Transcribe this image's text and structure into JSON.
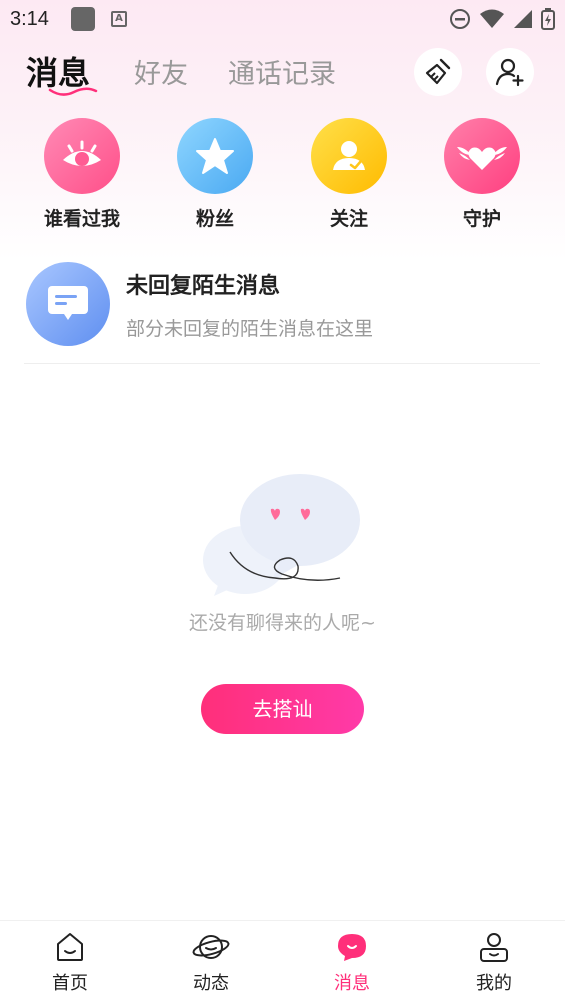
{
  "status_bar": {
    "time": "3:14",
    "notif_letter": "A"
  },
  "header": {
    "tabs": [
      {
        "label": "消息",
        "active": true
      },
      {
        "label": "好友",
        "active": false
      },
      {
        "label": "通话记录",
        "active": false
      }
    ],
    "clean_icon": "broom-icon",
    "add_friend_icon": "add-user-icon"
  },
  "shortcuts": [
    {
      "label": "谁看过我",
      "icon": "eye-icon",
      "color": "#ff5c93"
    },
    {
      "label": "粉丝",
      "icon": "star-icon",
      "color": "#5bbdf7"
    },
    {
      "label": "关注",
      "icon": "person-check-icon",
      "color": "#ffc61a"
    },
    {
      "label": "守护",
      "icon": "winged-heart-icon",
      "color": "#ff4d8d"
    }
  ],
  "stranger_msg": {
    "title": "未回复陌生消息",
    "subtitle": "部分未回复的陌生消息在这里"
  },
  "empty_state": {
    "text": "还没有聊得来的人呢~",
    "cta_label": "去搭讪"
  },
  "bottom_nav": [
    {
      "label": "首页",
      "icon": "home-icon",
      "active": false
    },
    {
      "label": "动态",
      "icon": "planet-icon",
      "active": false
    },
    {
      "label": "消息",
      "icon": "message-icon",
      "active": true
    },
    {
      "label": "我的",
      "icon": "profile-icon",
      "active": false
    }
  ],
  "colors": {
    "accent": "#ff2f7a",
    "text": "#222222",
    "muted": "#999999"
  }
}
